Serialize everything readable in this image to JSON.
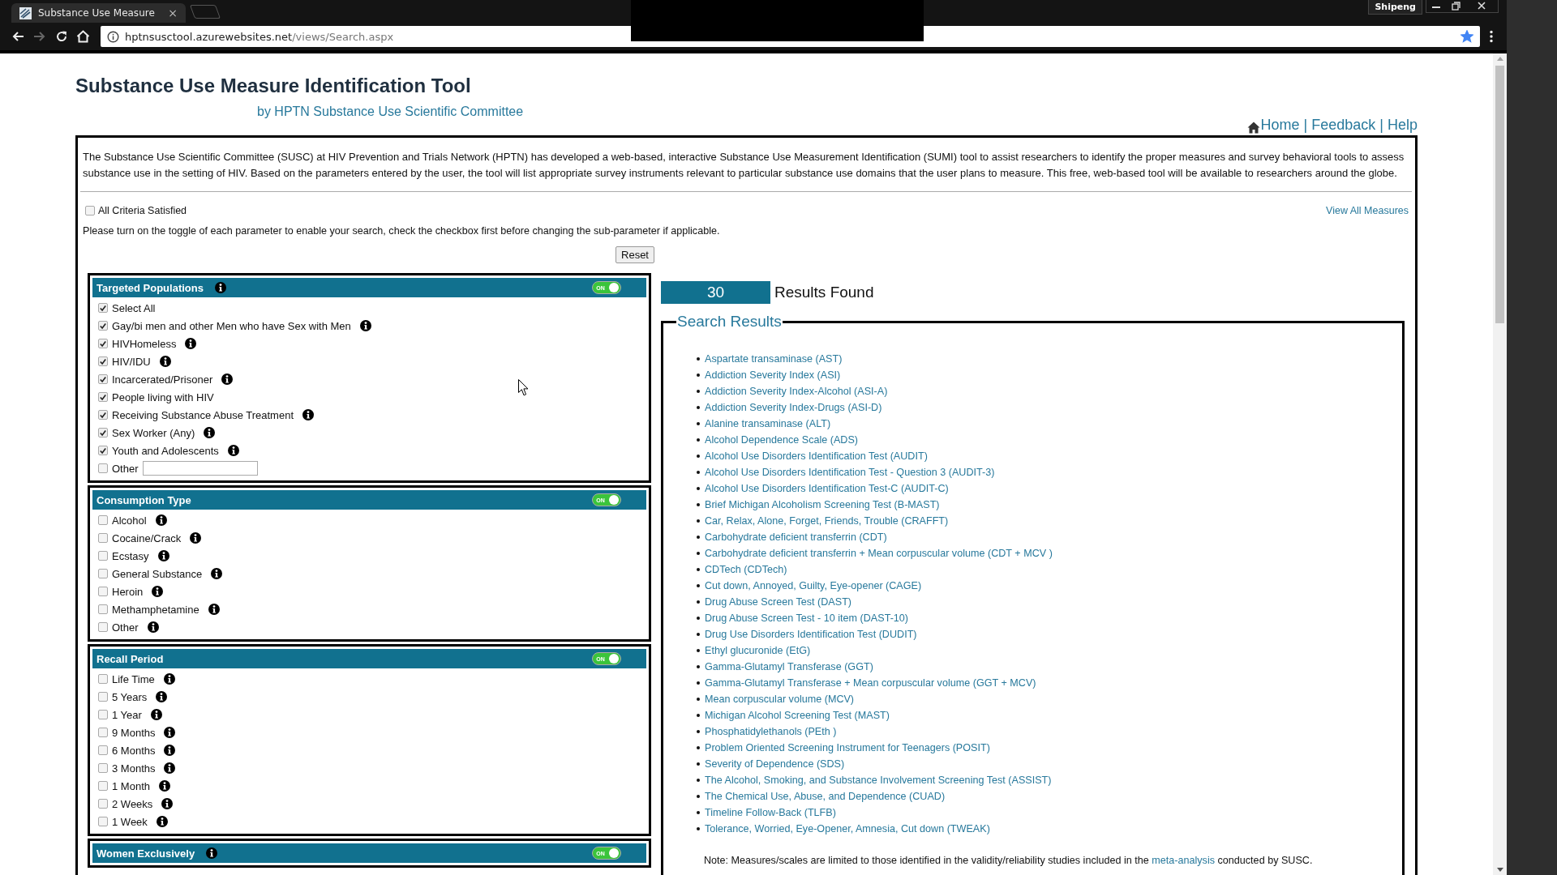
{
  "browser": {
    "tab_title": "Substance Use Measure",
    "tab_close": "×",
    "url_host": "hptnsusctool.azurewebsites.net",
    "url_path": "/views/Search.aspx",
    "profile": "Shipeng",
    "bookmarked": true
  },
  "header": {
    "title": "Substance Use Measure Identification Tool",
    "subtitle": "by HPTN Substance Use Scientific Committee",
    "nav": [
      {
        "kind": "home_link",
        "label": "Home"
      },
      {
        "kind": "separator",
        "label": "|"
      },
      {
        "kind": "link",
        "label": "Feedback"
      },
      {
        "kind": "separator",
        "label": "|"
      },
      {
        "kind": "link",
        "label": "Help"
      }
    ]
  },
  "intro": "The Substance Use Scientific Committee (SUSC) at HIV Prevention and Trials Network (HPTN) has developed a web-based, interactive Substance Use Measurement Identification (SUMI) tool to assist researchers to identify the proper measures and survey behavioral tools to assess substance use in the setting of HIV. Based on the parameters entered by the user, the tool will list appropriate survey instruments relevant to particular substance use domains that the user plans to measure. This free, web-based tool will be available to researchers around the globe.",
  "all_criteria": {
    "label": "All Criteria Satisfied",
    "checked": false
  },
  "view_all": "View All Measures",
  "instruction": "Please turn on the toggle of each parameter to enable your search, check the checkbox first before changing the sub-parameter if applicable.",
  "reset": "Reset",
  "panels": [
    {
      "title": "Targeted Populations",
      "info": true,
      "toggle": {
        "label": "ON",
        "on": true
      },
      "options": [
        {
          "kind": "checkbox",
          "label": "Select All",
          "checked": true,
          "info": false
        },
        {
          "kind": "checkbox",
          "label": "Gay/bi men and other Men who have Sex with Men",
          "checked": true,
          "info": true
        },
        {
          "kind": "checkbox",
          "label": "HIVHomeless",
          "checked": true,
          "info": true
        },
        {
          "kind": "checkbox",
          "label": "HIV/IDU",
          "checked": true,
          "info": true
        },
        {
          "kind": "checkbox",
          "label": "Incarcerated/Prisoner",
          "checked": true,
          "info": true
        },
        {
          "kind": "checkbox",
          "label": "People living with HIV",
          "checked": true,
          "info": false
        },
        {
          "kind": "checkbox",
          "label": "Receiving Substance Abuse Treatment",
          "checked": true,
          "info": true
        },
        {
          "kind": "checkbox",
          "label": "Sex Worker (Any)",
          "checked": true,
          "info": true
        },
        {
          "kind": "checkbox",
          "label": "Youth and Adolescents",
          "checked": true,
          "info": true
        },
        {
          "kind": "checkbox_field",
          "label": "Other",
          "checked": false,
          "info": false
        }
      ]
    },
    {
      "title": "Consumption Type",
      "info": false,
      "toggle": {
        "label": "ON",
        "on": true
      },
      "options": [
        {
          "kind": "checkbox",
          "label": "Alcohol",
          "checked": false,
          "info": true
        },
        {
          "kind": "checkbox",
          "label": "Cocaine/Crack",
          "checked": false,
          "info": true
        },
        {
          "kind": "checkbox",
          "label": "Ecstasy",
          "checked": false,
          "info": true
        },
        {
          "kind": "checkbox",
          "label": "General Substance",
          "checked": false,
          "info": true
        },
        {
          "kind": "checkbox",
          "label": "Heroin",
          "checked": false,
          "info": true
        },
        {
          "kind": "checkbox",
          "label": "Methamphetamine",
          "checked": false,
          "info": true
        },
        {
          "kind": "checkbox",
          "label": "Other",
          "checked": false,
          "info": true
        }
      ]
    },
    {
      "title": "Recall Period",
      "info": false,
      "toggle": {
        "label": "ON",
        "on": true
      },
      "options": [
        {
          "kind": "checkbox",
          "label": "Life Time",
          "checked": false,
          "info": true
        },
        {
          "kind": "checkbox",
          "label": "5 Years",
          "checked": false,
          "info": true
        },
        {
          "kind": "checkbox",
          "label": "1 Year",
          "checked": false,
          "info": true
        },
        {
          "kind": "checkbox",
          "label": "9 Months",
          "checked": false,
          "info": true
        },
        {
          "kind": "checkbox",
          "label": "6 Months",
          "checked": false,
          "info": true
        },
        {
          "kind": "checkbox",
          "label": "3 Months",
          "checked": false,
          "info": true
        },
        {
          "kind": "checkbox",
          "label": "1 Month",
          "checked": false,
          "info": true
        },
        {
          "kind": "checkbox",
          "label": "2 Weeks",
          "checked": false,
          "info": true
        },
        {
          "kind": "checkbox",
          "label": "1 Week",
          "checked": false,
          "info": true
        }
      ]
    },
    {
      "title": "Women Exclusively",
      "info": true,
      "toggle": {
        "label": "ON",
        "on": true
      }
    }
  ],
  "results": {
    "count": "30",
    "count_label": "Results Found",
    "legend": "Search Results",
    "items": [
      "Aspartate transaminase (AST)",
      "Addiction Severity Index (ASI)",
      "Addiction Severity Index-Alcohol (ASI-A)",
      "Addiction Severity Index-Drugs (ASI-D)",
      "Alanine transaminase (ALT)",
      "Alcohol Dependence Scale (ADS)",
      "Alcohol Use Disorders Identification Test (AUDIT)",
      "Alcohol Use Disorders Identification Test - Question 3 (AUDIT-3)",
      "Alcohol Use Disorders Identification Test-C (AUDIT-C)",
      "Brief Michigan Alcoholism Screening Test (B-MAST)",
      "Car, Relax, Alone, Forget, Friends, Trouble (CRAFFT)",
      "Carbohydrate deficient transferrin (CDT)",
      "Carbohydrate deficient transferrin + Mean corpuscular volume (CDT + MCV )",
      "CDTech (CDTech)",
      "Cut down, Annoyed, Guilty, Eye-opener (CAGE)",
      "Drug Abuse Screen Test (DAST)",
      "Drug Abuse Screen Test - 10 item (DAST-10)",
      "Drug Use Disorders Identification Test (DUDIT)",
      "Ethyl glucuronide (EtG)",
      "Gamma-Glutamyl Transferase (GGT)",
      "Gamma-Glutamyl Transferase + Mean corpuscular volume (GGT + MCV)",
      "Mean corpuscular volume (MCV)",
      "Michigan Alcohol Screening Test (MAST)",
      "Phosphatidylethanols (PEth )",
      "Problem Oriented Screening Instrument for Teenagers (POSIT)",
      "Severity of Dependence (SDS)",
      "The Alcohol, Smoking, and Substance Involvement Screening Test (ASSIST)",
      "The Chemical Use, Abuse, and Dependence (CUAD)",
      "Timeline Follow-Back (TLFB)",
      "Tolerance, Worried, Eye-Opener, Amnesia, Cut down (TWEAK)"
    ],
    "note_before": "Note: Measures/scales are limited to those identified in the validity/reliability studies included in the ",
    "note_link": "meta-analysis",
    "note_after": " conducted by SUSC."
  }
}
